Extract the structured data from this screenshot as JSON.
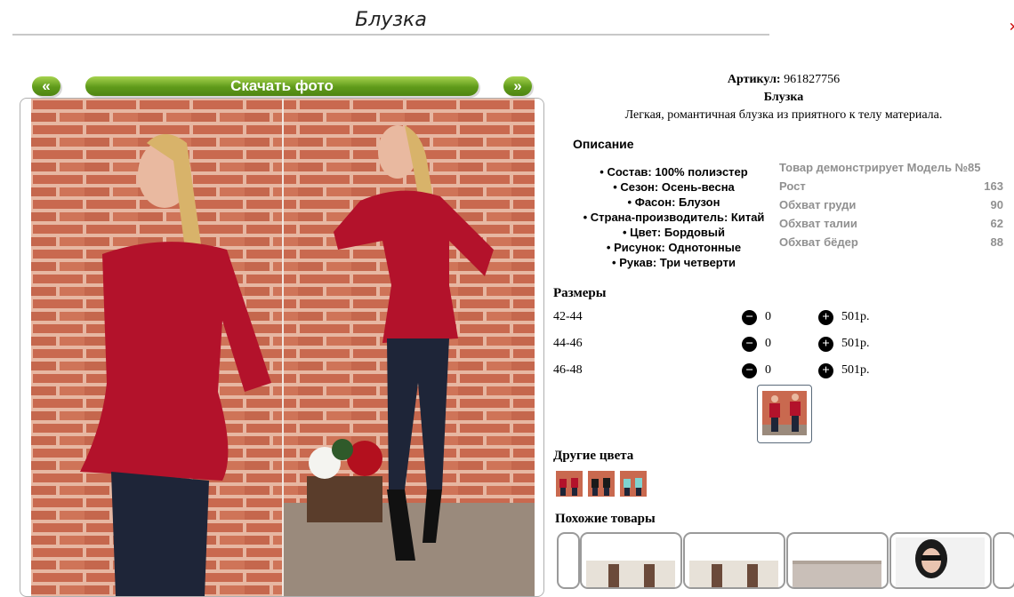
{
  "page": {
    "title": "Блузка"
  },
  "gallery": {
    "prev_label": "«",
    "download_label": "Скачать фото",
    "next_label": "»"
  },
  "product": {
    "article_label": "Артикул:",
    "article_value": "961827756",
    "name": "Блузка",
    "summary": "Легкая, романтичная блузка из приятного к телу материала.",
    "description_heading": "Описание",
    "details": [
      "Состав: 100% полиэстер",
      "Сезон: Осень-весна",
      "Фасон: Блузон",
      "Страна-производитель: Китай",
      "Цвет: Бордовый",
      "Рисунок: Однотонные",
      "Рукав: Три четверти"
    ]
  },
  "model": {
    "heading": "Товар демонстрирует Модель №85",
    "rows": [
      {
        "label": "Рост",
        "value": "163"
      },
      {
        "label": "Обхват груди",
        "value": "90"
      },
      {
        "label": "Обхват талии",
        "value": "62"
      },
      {
        "label": "Обхват бёдер",
        "value": "88"
      }
    ]
  },
  "sizes": {
    "heading": "Размеры",
    "items": [
      {
        "size": "42-44",
        "qty": "0",
        "price": "501р."
      },
      {
        "size": "44-46",
        "qty": "0",
        "price": "501р."
      },
      {
        "size": "46-48",
        "qty": "0",
        "price": "501р."
      }
    ],
    "minus_symbol": "−",
    "plus_symbol": "+"
  },
  "other_colors": {
    "heading": "Другие цвета"
  },
  "similar": {
    "heading": "Похожие товары"
  },
  "colors": {
    "accent_green": "#5f9a1a",
    "blouse_red": "#b3122b",
    "brick": "#c9694f",
    "jeans": "#1e2538"
  }
}
